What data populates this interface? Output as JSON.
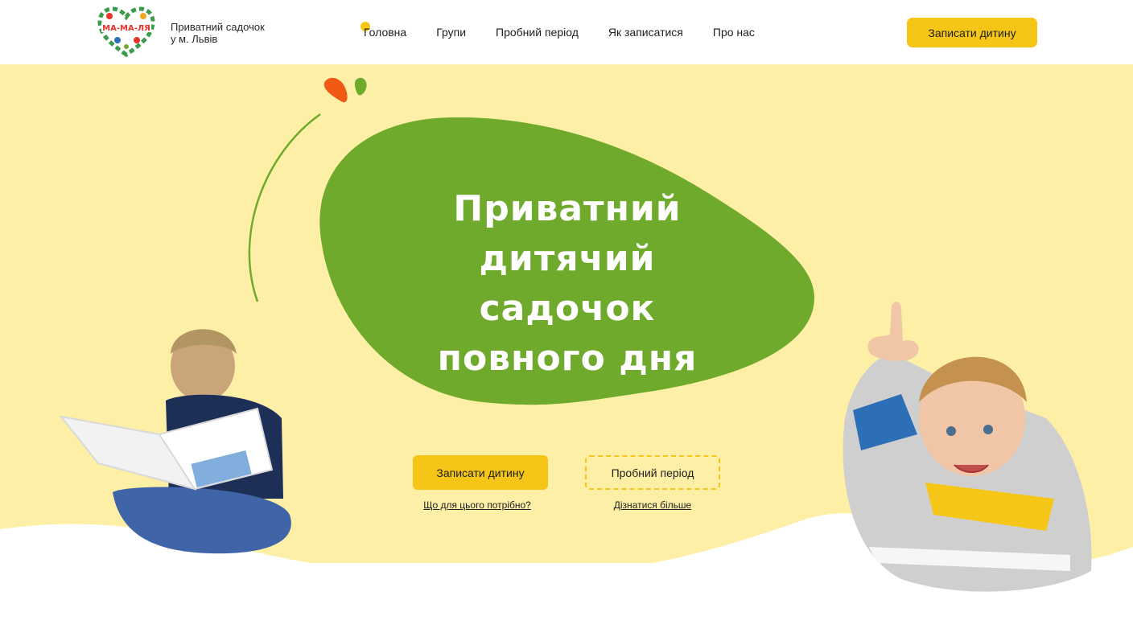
{
  "header": {
    "logo_text": "МА-МА-ЛЯ",
    "tagline_line1": "Приватний садочок",
    "tagline_line2": "у м. Львів",
    "nav": [
      "Головна",
      "Групи",
      "Пробний період",
      "Як записатися",
      "Про нас"
    ],
    "cta": "Записати дитину"
  },
  "hero": {
    "title_lines": [
      "Приватний",
      "дитячий",
      "садочок",
      "повного дня"
    ],
    "primary_button": "Записати дитину",
    "secondary_button": "Пробний період",
    "primary_link": "Що для цього потрібно?",
    "secondary_link": "Дізнатися більше"
  },
  "colors": {
    "accent_yellow": "#f5c518",
    "hero_bg": "#fdf0a6",
    "blob_green": "#6faa2c",
    "orange": "#f05a14"
  }
}
